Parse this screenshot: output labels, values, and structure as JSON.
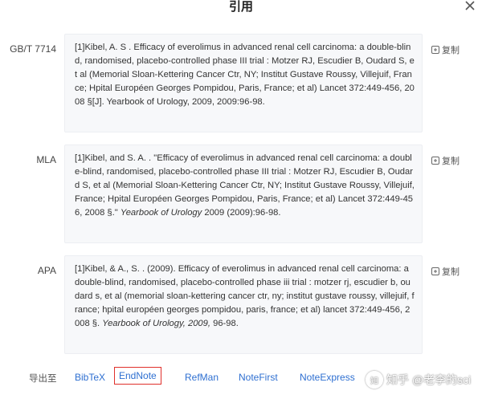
{
  "dialog": {
    "title": "引用",
    "close_icon": "close-icon"
  },
  "copy_label": "复制",
  "citations": [
    {
      "style": "GB/T 7714",
      "text": "[1]Kibel, A. S . Efficacy of everolimus in advanced renal cell carcinoma: a double-blind, randomised, placebo-controlled phase III trial : Motzer RJ, Escudier B, Oudard S, et al (Memorial Sloan-Kettering Cancer Ctr, NY; Institut Gustave Roussy, Villejuif, France; Hpital Européen Georges Pompidou, Paris, France; et al) Lancet 372:449-456, 2008 §[J]. Yearbook of Urology, 2009, 2009:96-98.",
      "italic": "",
      "tail": ""
    },
    {
      "style": "MLA",
      "text": "[1]Kibel, and S. A. . \"Efficacy of everolimus in advanced renal cell carcinoma: a double-blind, randomised, placebo-controlled phase III trial : Motzer RJ, Escudier B, Oudard S, et al (Memorial Sloan-Kettering Cancer Ctr, NY; Institut Gustave Roussy, Villejuif, France; Hpital Européen Georges Pompidou, Paris, France; et al) Lancet 372:449-456, 2008 §.\" ",
      "italic": "Yearbook of Urology",
      "tail": " 2009 (2009):96-98."
    },
    {
      "style": "APA",
      "text": "[1]Kibel, & A., S. . (2009). Efficacy of everolimus in advanced renal cell carcinoma: a double-blind, randomised, placebo-controlled phase iii trial : motzer rj, escudier b, oudard s, et al (memorial sloan-kettering cancer ctr, ny; institut gustave roussy, villejuif, france; hpital européen georges pompidou, paris, france; et al) lancet 372:449-456, 2008 §. ",
      "italic": "Yearbook of Urology, 2009,",
      "tail": " 96-98."
    }
  ],
  "export": {
    "label": "导出至",
    "links": [
      "BibTeX",
      "EndNote",
      "RefMan",
      "NoteFirst",
      "NoteExpress"
    ],
    "selected": "EndNote"
  },
  "watermark": {
    "text": "知乎 @老李的sci",
    "logo_glyph": "知"
  },
  "colors": {
    "link": "#2e6fd1",
    "highlight_border": "#e0302b",
    "citation_bg": "#f7f8fa"
  }
}
